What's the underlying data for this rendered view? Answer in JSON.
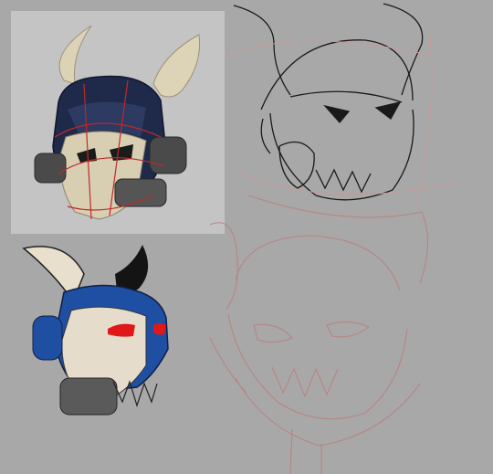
{
  "canvas": {
    "background_color": "#a8a8a8",
    "reference_panel_color": "#c4c4c4"
  },
  "artworks": [
    {
      "name": "rendered-3d-helmet",
      "colors": {
        "bone": "#d8cfb2",
        "armor": "#1f2a4a",
        "metal": "#4a4a4a",
        "sketch_lines": "#c0282b"
      }
    },
    {
      "name": "ink-sketch-helmet",
      "colors": {
        "ink": "#1a1a1a",
        "construction": "#c79a9a"
      }
    },
    {
      "name": "colored-flat-helmet",
      "colors": {
        "bone": "#e6dccb",
        "armor": "#1f4fa3",
        "eyes": "#e01818",
        "metal": "#5a5a5a",
        "horn": "#141414"
      }
    },
    {
      "name": "rough-red-sketch",
      "colors": {
        "line": "#b98484"
      }
    }
  ]
}
